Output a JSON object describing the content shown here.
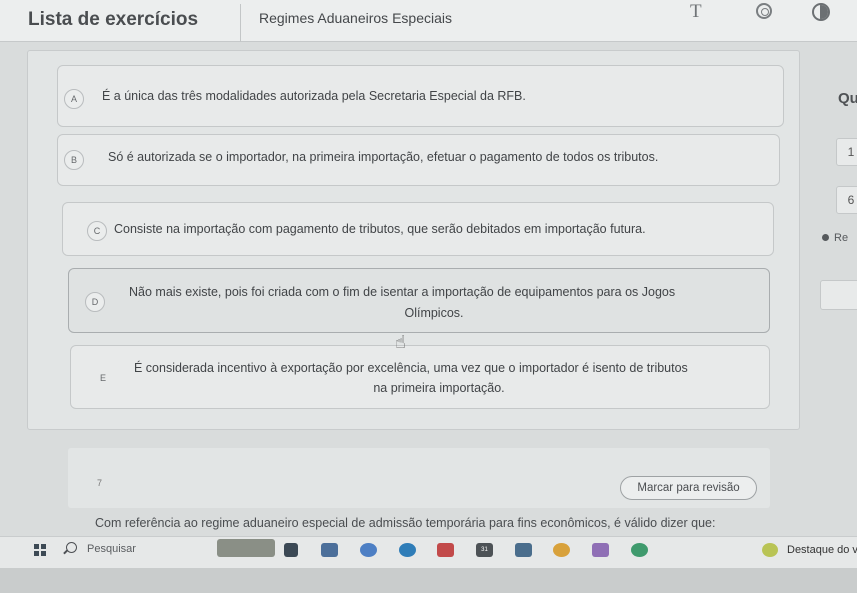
{
  "header": {
    "app_title": "Lista de exercícios",
    "subject": "Regimes Aduaneiros Especiais",
    "font_tool_label": "T"
  },
  "options": [
    {
      "letter": "A",
      "text": "É a única das três modalidades autorizada pela Secretaria Especial da RFB."
    },
    {
      "letter": "B",
      "text": "Só é autorizada se o importador, na primeira importação, efetuar o pagamento de todos os tributos."
    },
    {
      "letter": "C",
      "text": "Consiste na importação com pagamento de tributos, que serão debitados em importação futura."
    },
    {
      "letter": "D",
      "line1": "Não mais existe, pois foi criada com o fim de isentar a importação de equipamentos para os Jogos",
      "line2": "Olímpicos."
    },
    {
      "letter": "E",
      "line1": "É considerada incentivo à exportação por excelência, uma vez que o importador é isento de tributos",
      "line2": "na primeira importação."
    }
  ],
  "right_panel": {
    "title": "Qu",
    "box_1": "1",
    "box_2": "6",
    "legend": "Re"
  },
  "next_question": {
    "number": "7",
    "review_label": "Marcar para revisão",
    "text": "Com referência ao regime aduaneiro especial de admissão temporária para fins econômicos, é válido dizer que:"
  },
  "taskbar": {
    "search_label": "Pesquisar",
    "highlight_label": "Destaque do v",
    "calendar_label": "31"
  }
}
